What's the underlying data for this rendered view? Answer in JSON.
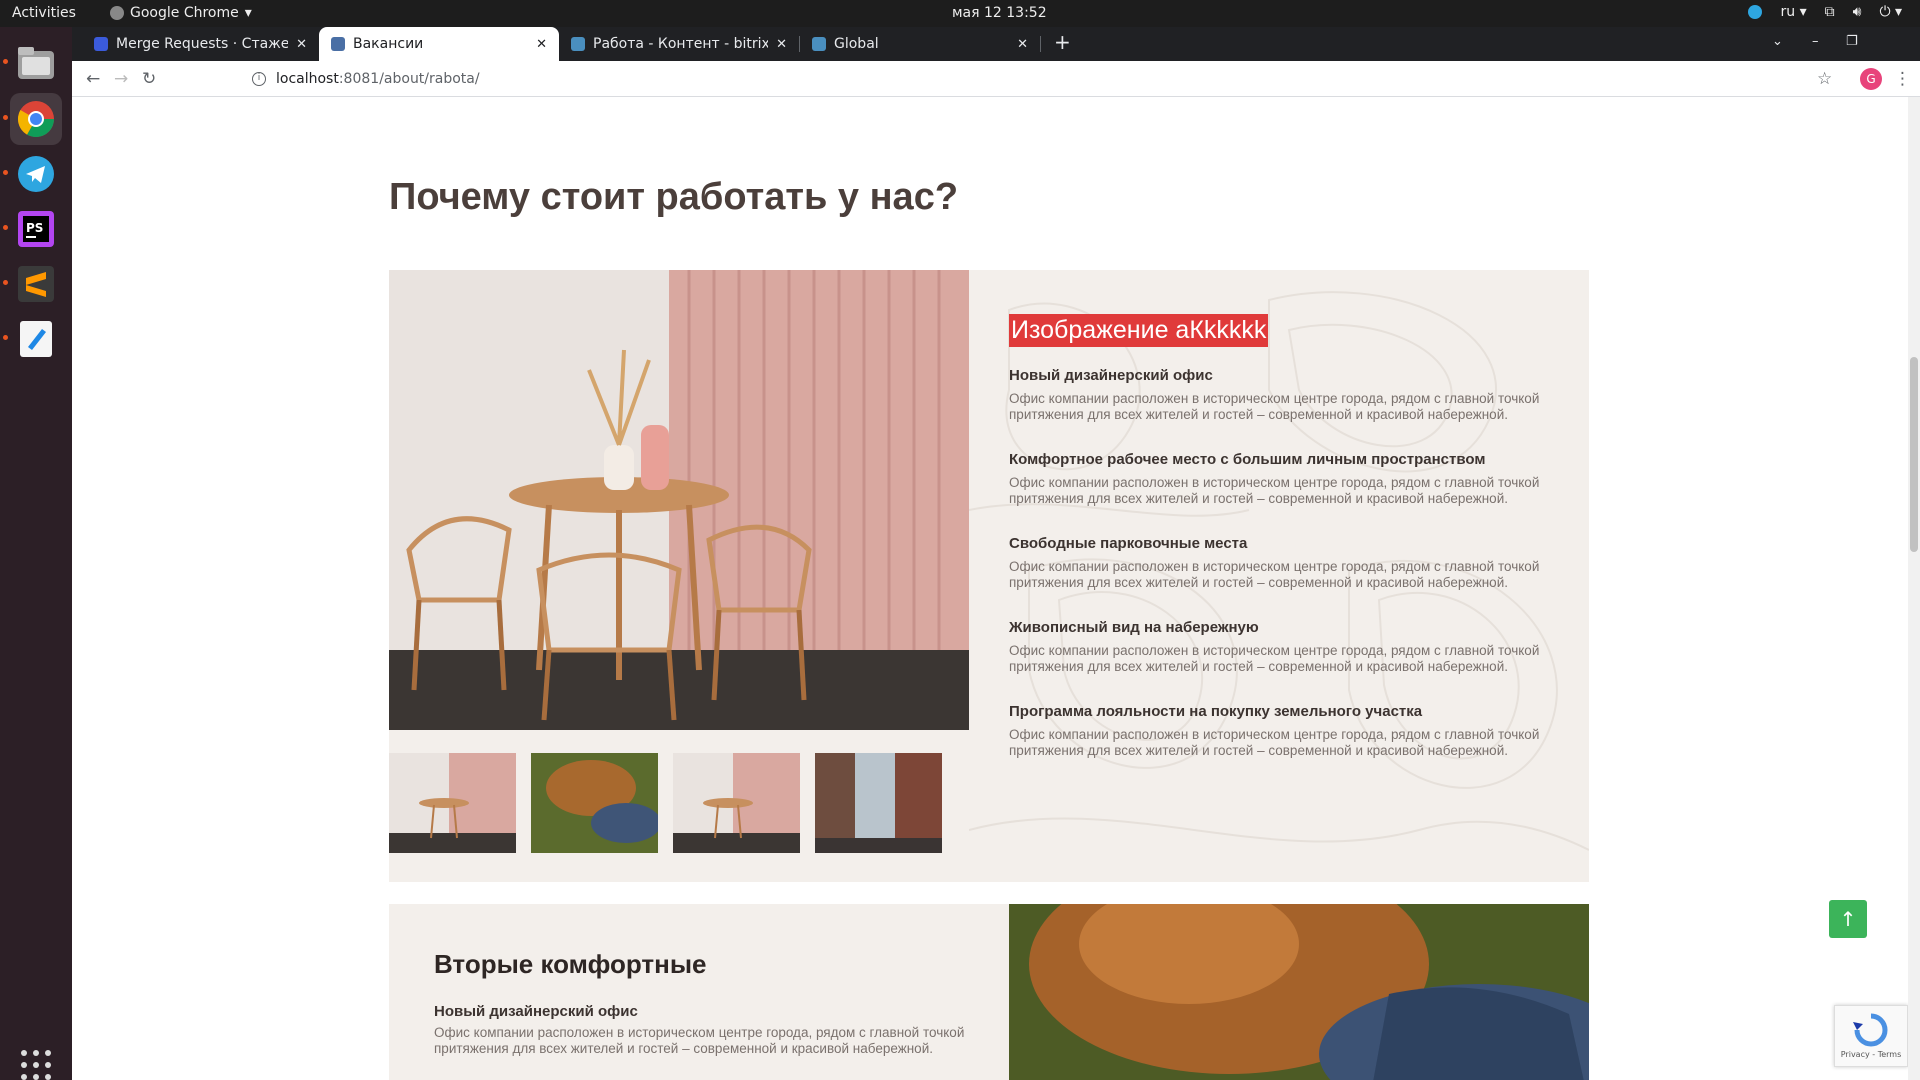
{
  "system": {
    "activities": "Activities",
    "app_name": "Google Chrome",
    "clock": "мая 12  13:52",
    "lang": "ru"
  },
  "browser": {
    "tabs": [
      {
        "title": "Merge Requests · Стажер",
        "active": false
      },
      {
        "title": "Вакансии",
        "active": true
      },
      {
        "title": "Работа - Контент - bitrix",
        "active": false
      },
      {
        "title": "Global",
        "active": false
      }
    ],
    "url_host": "localhost",
    "url_rest": ":8081/about/rabota/",
    "avatar_letter": "G"
  },
  "page": {
    "title": "Почему стоит работать у нас?",
    "highlight_title": "Изображение аКkkkkk",
    "features": [
      {
        "heading": "Новый дизайнерский офис",
        "text": "Офис компании расположен в историческом центре города, рядом с главной точкой притяжения для всех жителей и гостей – современной и красивой набережной."
      },
      {
        "heading": "Комфортное рабочее место с большим личным пространством",
        "text": "Офис компании расположен в историческом центре города, рядом с главной точкой притяжения для всех жителей и гостей – современной и красивой набережной."
      },
      {
        "heading": "Свободные парковочные места",
        "text": "Офис компании расположен в историческом центре города, рядом с главной точкой притяжения для всех жителей и гостей – современной и красивой набережной."
      },
      {
        "heading": "Живописный вид на набережную",
        "text": "Офис компании расположен в историческом центре города, рядом с главной точкой притяжения для всех жителей и гостей – современной и красивой набережной."
      },
      {
        "heading": "Программа лояльности на покупку земельного участка",
        "text": "Офис компании расположен в историческом центре города, рядом с главной точкой притяжения для всех жителей и гостей – современной и красивой набережной."
      }
    ],
    "second": {
      "title": "Вторые комфортные",
      "heading": "Новый дизайнерский офис",
      "text": "Офис компании расположен в историческом центре города, рядом с главной точкой притяжения для всех жителей и гостей – современной и красивой набережной."
    },
    "recaptcha_text": "Privacy - Terms"
  },
  "colors": {
    "highlight": "#e03a3a",
    "block_bg": "#f3efeb",
    "up_button": "#3cb45a"
  }
}
